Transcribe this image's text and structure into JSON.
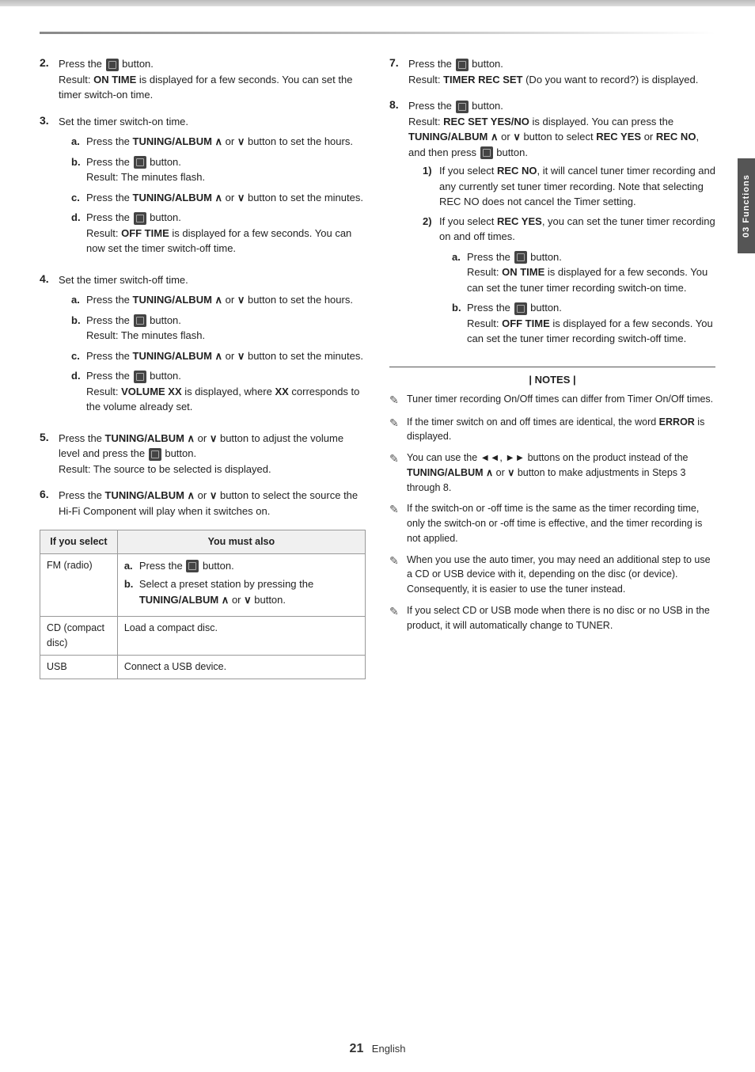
{
  "page": {
    "top_bar": true,
    "side_tab": "03 Functions",
    "footer_num": "21",
    "footer_lang": "English"
  },
  "left_col": {
    "steps": [
      {
        "num": "2.",
        "text": "Press the",
        "has_icon": true,
        "text2": "button.",
        "result": "Result: ",
        "result_bold": "ON TIME",
        "result_rest": " is displayed for a few seconds. You can set the timer switch-on time.",
        "sub_steps": []
      },
      {
        "num": "3.",
        "intro": "Set the timer switch-on time.",
        "sub_steps": [
          {
            "label": "a.",
            "text": "Press the ",
            "has_icon": false,
            "bold": "TUNING/ALBUM ∧",
            "rest": " or ",
            "bold2": "∨",
            "rest2": " button to set the hours."
          },
          {
            "label": "b.",
            "text": "Press the ",
            "has_icon": true,
            "rest": " button.",
            "result": "Result: The minutes flash."
          },
          {
            "label": "c.",
            "text": "Press the ",
            "has_icon": false,
            "bold": "TUNING/ALBUM ∧",
            "rest": " or ",
            "bold2": "∨",
            "rest2": " button to set the minutes."
          },
          {
            "label": "d.",
            "text": "Press the ",
            "has_icon": true,
            "rest": " button.",
            "result": "Result: ",
            "result_bold": "OFF TIME",
            "result_rest": " is displayed for a few seconds. You can now set the timer switch-off time."
          }
        ]
      },
      {
        "num": "4.",
        "intro": "Set the timer switch-off time.",
        "sub_steps": [
          {
            "label": "a.",
            "bold": "TUNING/ALBUM ∧",
            "rest": " or ",
            "bold2": "∨",
            "rest2": " button to set the hours.",
            "prefix": "Press the "
          },
          {
            "label": "b.",
            "prefix": "Press the ",
            "has_icon": true,
            "rest": " button.",
            "result": "Result: The minutes flash."
          },
          {
            "label": "c.",
            "prefix": "Press the ",
            "bold": "TUNING/ALBUM ∧",
            "rest": " or ",
            "bold2": "∨",
            "rest2": " button to set the minutes."
          },
          {
            "label": "d.",
            "prefix": "Press the ",
            "has_icon": true,
            "rest": " button.",
            "result": "Result: ",
            "result_bold": "VOLUME XX",
            "result_rest": " is displayed, where ",
            "result_bold2": "XX",
            "result_rest2": " corresponds to the volume already set."
          }
        ]
      },
      {
        "num": "5.",
        "text_parts": [
          {
            "text": "Press the ",
            "bold": "TUNING/ALBUM ∧",
            "rest": " or ",
            "bold2": "∨",
            "rest2": " button to adjust the volume level and press the "
          },
          {
            "has_icon": true
          },
          {
            "text": " button."
          },
          {
            "newline": true,
            "text": "Result: The source to be selected is displayed."
          }
        ]
      },
      {
        "num": "6.",
        "text_parts": [
          {
            "text": "Press the ",
            "bold": "TUNING/ALBUM ∧",
            "rest": " or ",
            "bold2": "∨",
            "rest2": " button to select the source the Hi-Fi Component will play when it switches on."
          }
        ]
      }
    ],
    "table": {
      "headers": [
        "If you select",
        "You must also"
      ],
      "rows": [
        {
          "col1": "FM (radio)",
          "col2_parts": [
            {
              "label": "a.",
              "text": "Press the ",
              "has_icon": true,
              "rest": " button."
            },
            {
              "label": "b.",
              "text": "Select a preset station by pressing the ",
              "bold": "TUNING/ALBUM ∧",
              "rest": " or ",
              "bold2": "∨",
              "rest2": " button."
            }
          ]
        },
        {
          "col1": "CD (compact disc)",
          "col2": "Load a compact disc."
        },
        {
          "col1": "USB",
          "col2": "Connect a USB device."
        }
      ]
    }
  },
  "right_col": {
    "steps": [
      {
        "num": "7.",
        "text": "Press the ",
        "has_icon": true,
        "rest": " button.",
        "result": "Result: ",
        "result_bold": "TIMER REC SET",
        "result_rest": " (Do you want to record?) is displayed."
      },
      {
        "num": "8.",
        "text": "Press the ",
        "has_icon": true,
        "rest": " button.",
        "result": "Result: ",
        "result_bold": "REC SET YES/NO",
        "result_rest": " is displayed. You can press the ",
        "result_bold2": "TUNING/ALBUM ∧",
        "result_rest2": " or ",
        "result_bold3": "∨",
        "result_rest3": " button to select ",
        "result_bold4": "REC YES",
        "result_rest4": " or ",
        "result_bold5": "REC NO",
        "result_rest5": ", and then press ",
        "result_icon": true,
        "result_rest6": " button.",
        "sub_steps": [
          {
            "num": "1)",
            "text": "If you select ",
            "bold": "REC NO",
            "rest": ", it will cancel tuner timer recording and any currently set tuner timer recording. Note that selecting REC NO does not cancel the Timer setting."
          },
          {
            "num": "2)",
            "text": "If you select ",
            "bold": "REC YES",
            "rest": ", you can set the tuner timer recording on and off times.",
            "sub_steps": [
              {
                "label": "a.",
                "prefix": "Press the ",
                "has_icon": true,
                "rest": " button.",
                "result": "Result: ",
                "result_bold": "ON TIME",
                "result_rest": " is displayed for a few seconds. You can set the tuner timer recording switch-on time."
              },
              {
                "label": "b.",
                "prefix": "Press the ",
                "has_icon": true,
                "rest": " button.",
                "result": "Result: ",
                "result_bold": "OFF TIME",
                "result_rest": " is displayed for a few seconds. You can set the tuner timer recording switch-off time."
              }
            ]
          }
        ]
      }
    ],
    "notes": {
      "title": "| NOTES |",
      "items": [
        "Tuner timer recording On/Off times can differ from Timer On/Off times.",
        "If the timer switch on and off times are identical, the word ERROR is displayed.",
        "You can use the ◄◄, ►► buttons on the product instead of the TUNING/ALBUM ∧ or ∨ button to make adjustments in Steps 3 through 8.",
        "If the switch-on or -off time is the same as the timer recording time, only the switch-on or -off time is effective, and the timer recording is not applied.",
        "When you use the auto timer, you may need an additional step to use a CD or USB device with it, depending on the disc (or device). Consequently, it is easier to use the tuner instead.",
        "If you select CD or USB mode when there is no disc or no USB in the product, it will automatically change to TUNER."
      ],
      "bold_words": [
        "ERROR",
        "TUNING/ALBUM ∧",
        "∨"
      ]
    }
  }
}
